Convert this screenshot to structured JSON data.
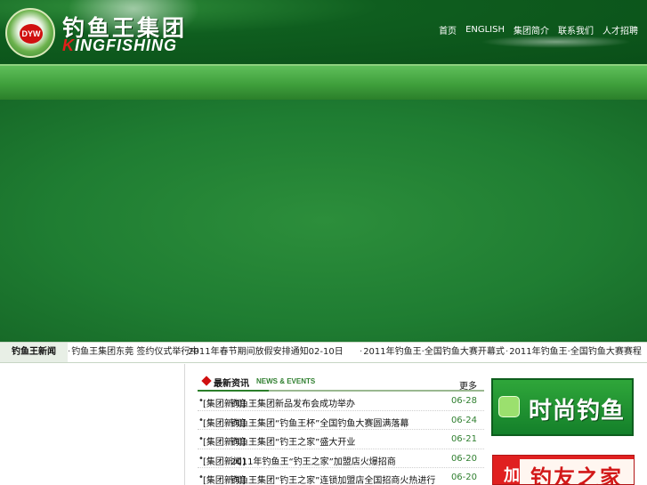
{
  "header": {
    "logo_cn": "钓鱼王集团",
    "logo_en_k": "K",
    "logo_en_rest": "INGFISHING",
    "badge_text": "DYW",
    "nav": [
      "首页",
      "ENGLISH",
      "集团简介",
      "联系我们",
      "人才招聘"
    ]
  },
  "ticker": {
    "label": "钓鱼王新闻",
    "items": [
      "钓鱼王集团东莞 签约仪式举行中",
      "2011年春节期间放假安排通知02-10日",
      "2011年钓鱼王·全国钓鱼大赛开幕式",
      "2011年钓鱼王·全国钓鱼大赛赛程"
    ]
  },
  "news": {
    "title": "最新资讯",
    "title_en": "NEWS & EVENTS",
    "more": "更多",
    "items": [
      {
        "cat": "[集团新闻]",
        "headline": "钓鱼王集团新品发布会成功举办",
        "date": "06-28"
      },
      {
        "cat": "[集团新闻]",
        "headline": "钓鱼王集团“钓鱼王杯”全国钓鱼大赛圆满落幕",
        "date": "06-24"
      },
      {
        "cat": "[集团新闻]",
        "headline": "钓鱼王集团“钓王之家”盛大开业",
        "date": "06-21"
      },
      {
        "cat": "[集团新闻]",
        "headline": "2011年钓鱼王“钓王之家”加盟店火爆招商",
        "date": "06-20"
      },
      {
        "cat": "[集团新闻]",
        "headline": "钓鱼王集团“钓王之家”连锁加盟店全国招商火热进行",
        "date": "06-20"
      }
    ]
  },
  "promos": {
    "promo1_text": "时尚钓鱼",
    "promo2_char": "加",
    "promo2_text": "钓友之家"
  },
  "colors": {
    "header_green": "#0f5e1f",
    "band_green": "#3f9f3c",
    "banner_green": "#1f7d32",
    "accent_red": "#d01010",
    "date_green": "#2f7f2f"
  }
}
